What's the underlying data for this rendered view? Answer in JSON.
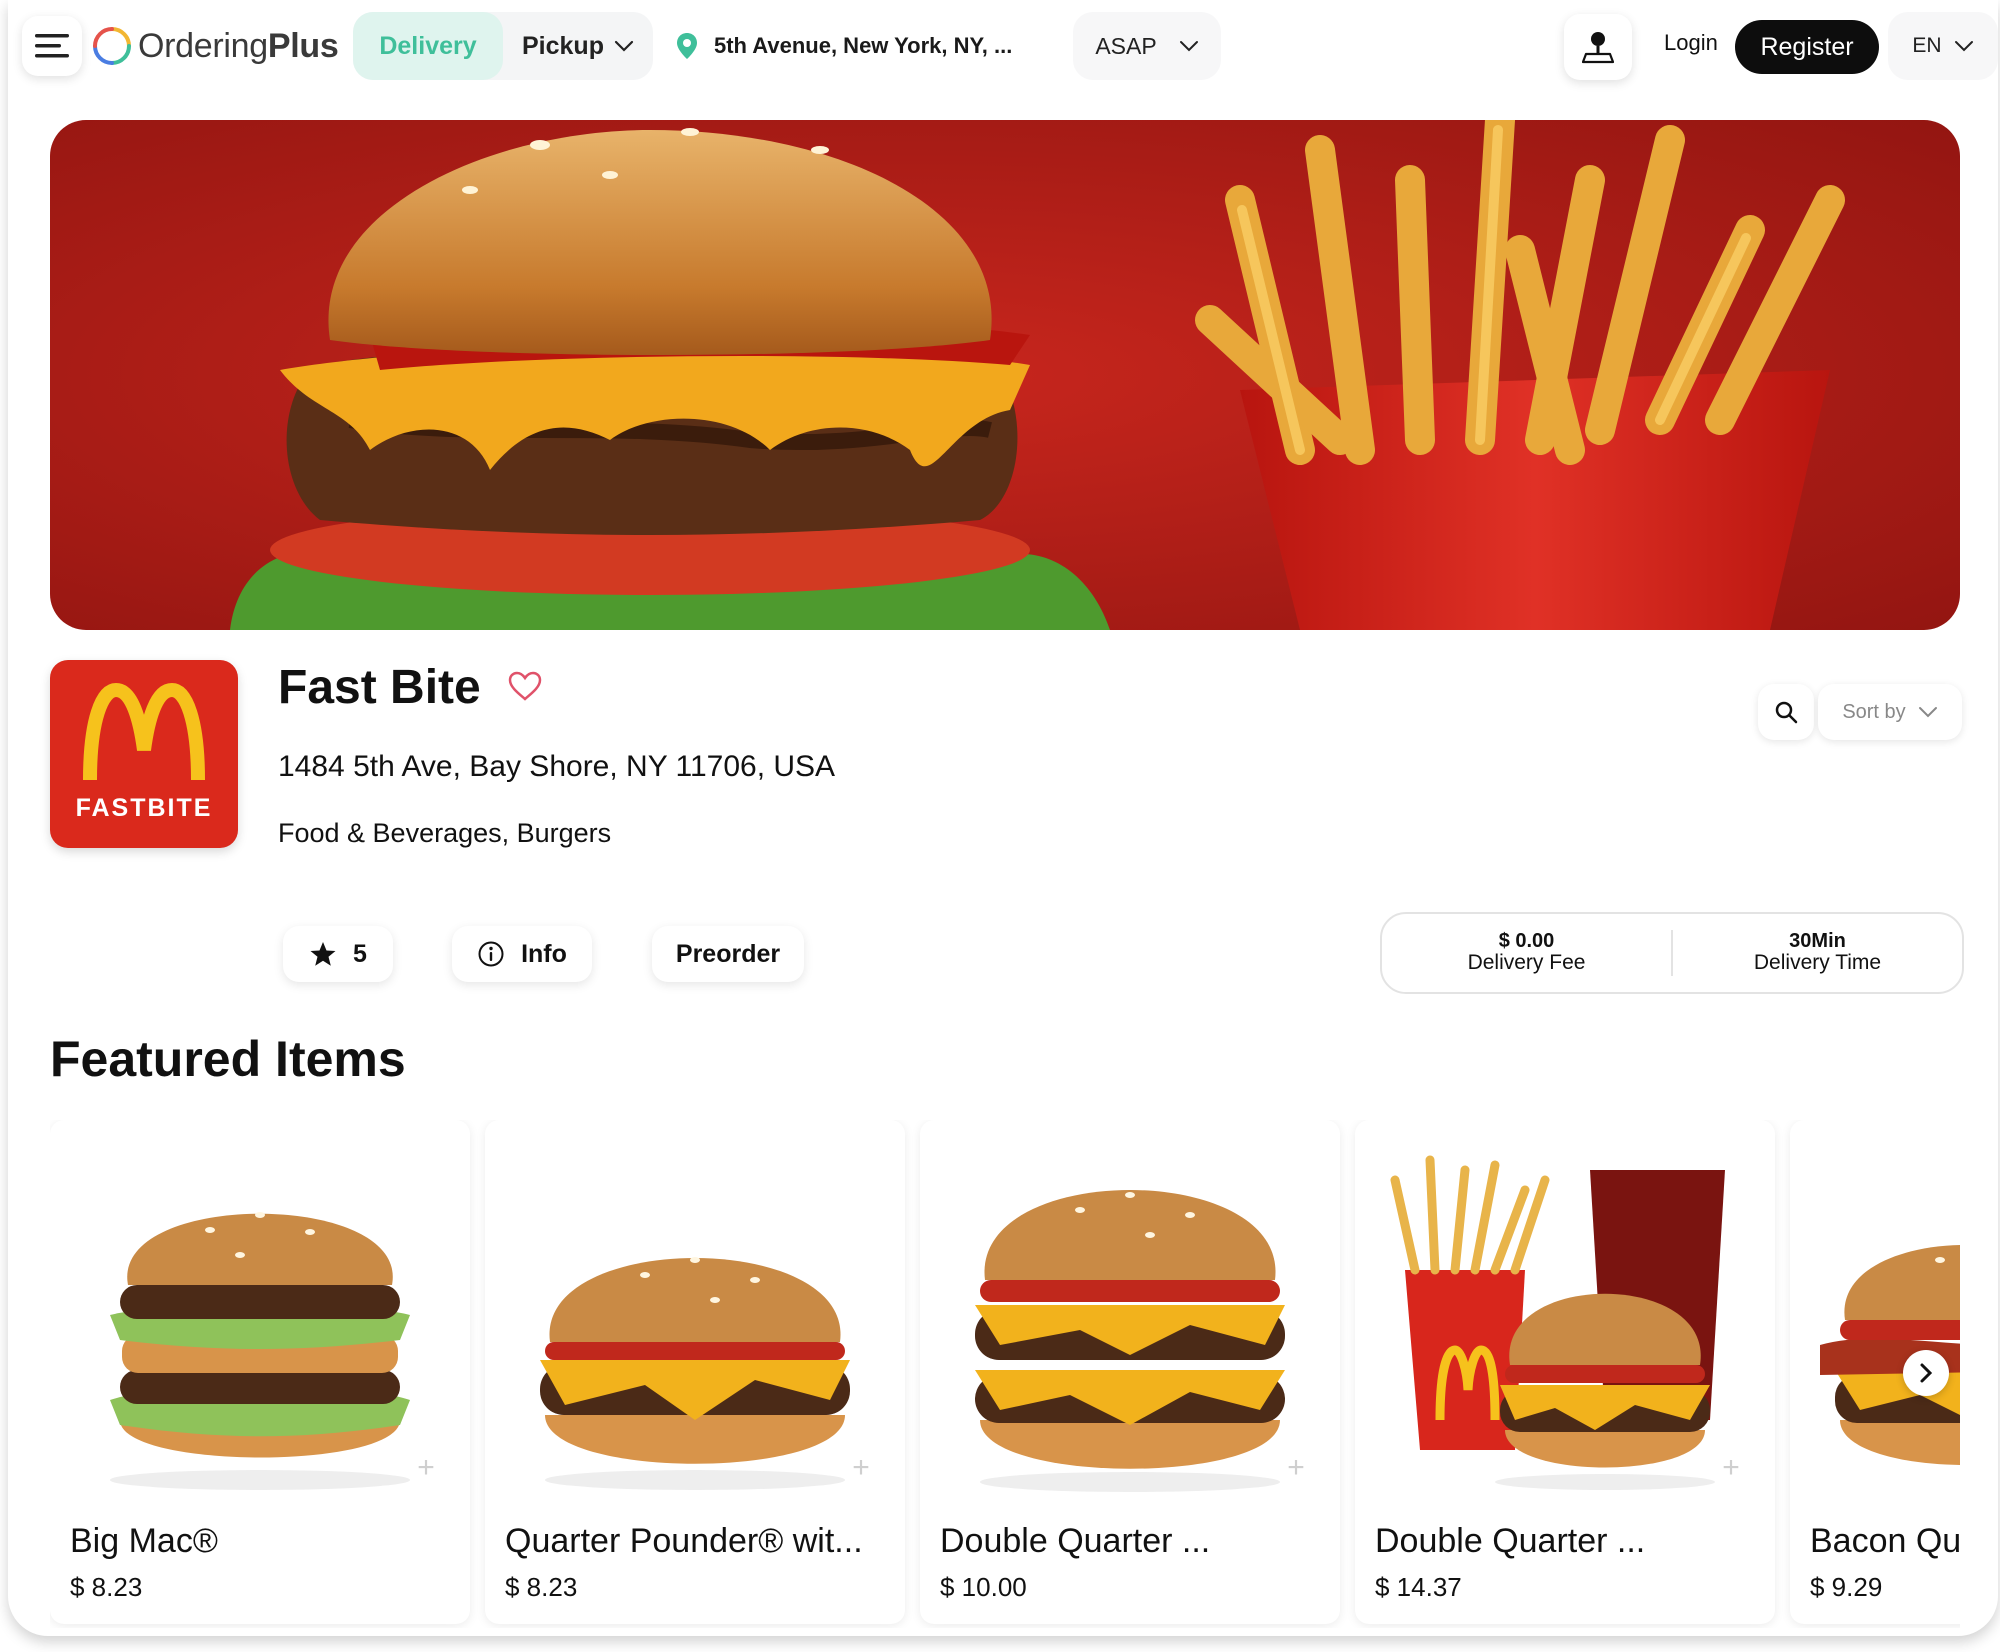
{
  "header": {
    "brand_light": "Ordering",
    "brand_bold": "Plus",
    "mode_delivery": "Delivery",
    "mode_pickup": "Pickup",
    "address": "5th Avenue, New York, NY, ...",
    "time": "ASAP",
    "login": "Login",
    "register": "Register",
    "language": "EN",
    "accent_color": "#3fbf9a"
  },
  "store": {
    "logo_text": "FASTBITE",
    "name": "Fast Bite",
    "address": "1484 5th Ave, Bay Shore, NY 11706, USA",
    "categories": "Food & Beverages, Burgers",
    "rating": "5",
    "info_label": "Info",
    "preorder_label": "Preorder",
    "sort_label": "Sort by",
    "delivery_fee_value": "$ 0.00",
    "delivery_fee_label": "Delivery Fee",
    "delivery_time_value": "30Min",
    "delivery_time_label": "Delivery Time",
    "brand_color": "#da291c"
  },
  "featured": {
    "title": "Featured Items",
    "items": [
      {
        "name": "Big Mac®",
        "price": "$ 8.23"
      },
      {
        "name": "Quarter Pounder® wit...",
        "price": "$ 8.23"
      },
      {
        "name": "Double Quarter ...",
        "price": "$ 10.00"
      },
      {
        "name": "Double Quarter ...",
        "price": "$ 14.37"
      },
      {
        "name": "Bacon Qu",
        "price": "$ 9.29"
      }
    ]
  }
}
